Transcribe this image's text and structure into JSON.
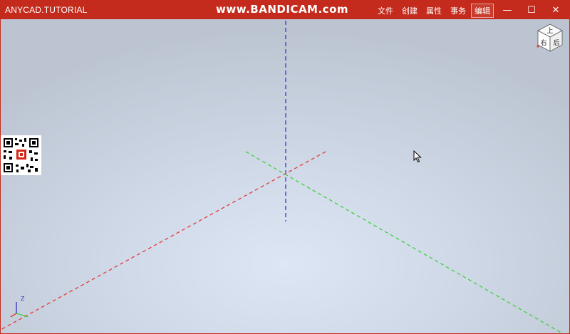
{
  "window": {
    "title": "ANYCAD.TUTORIAL",
    "watermark": "www.BANDICAM.com",
    "menu": [
      {
        "label": "文件",
        "active": false
      },
      {
        "label": "创建",
        "active": false
      },
      {
        "label": "属性",
        "active": false
      },
      {
        "label": "事务",
        "active": false
      },
      {
        "label": "编辑",
        "active": true
      }
    ],
    "controls": {
      "minimize": "—",
      "maximize": "☐",
      "close": "✕"
    }
  },
  "viewcube": {
    "top_label": "上",
    "left_label": "右",
    "right_label": "后"
  },
  "triad": {
    "z_label": "Z"
  },
  "colors": {
    "titlebar": "#c42b1c",
    "x_axis": "#e23b3b",
    "y_axis": "#3fd13f",
    "z_axis": "#3b3bc4"
  }
}
